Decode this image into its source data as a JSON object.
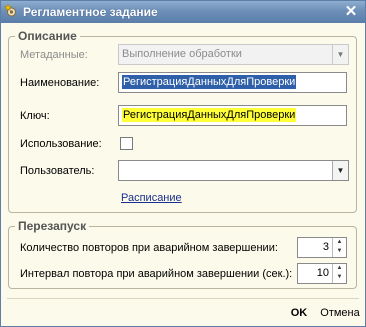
{
  "window": {
    "title": "Регламентное задание",
    "close_glyph": "✕"
  },
  "description_group": {
    "title": "Описание",
    "metadata_label": "Метаданные:",
    "metadata_value": "Выполнение обработки",
    "name_label": "Наименование:",
    "name_value": "РегистрацияДанныхДляПроверки",
    "key_label": "Ключ:",
    "key_value": "РегистрацияДанныхДляПроверки",
    "usage_label": "Использование:",
    "usage_checked": false,
    "user_label": "Пользователь:",
    "user_value": "",
    "schedule_link": "Расписание"
  },
  "restart_group": {
    "title": "Перезапуск",
    "retry_count_label": "Количество повторов при аварийном завершении:",
    "retry_count_value": "3",
    "retry_interval_label": "Интервал повтора при аварийном завершении (сек.):",
    "retry_interval_value": "10"
  },
  "buttons": {
    "ok_label": "OK",
    "cancel_label": "Отмена"
  },
  "icons": {
    "window_icon": "gear-star-icon",
    "dropdown": "chevron-down-icon",
    "spin_up": "spin-up-icon",
    "spin_down": "spin-down-icon"
  }
}
